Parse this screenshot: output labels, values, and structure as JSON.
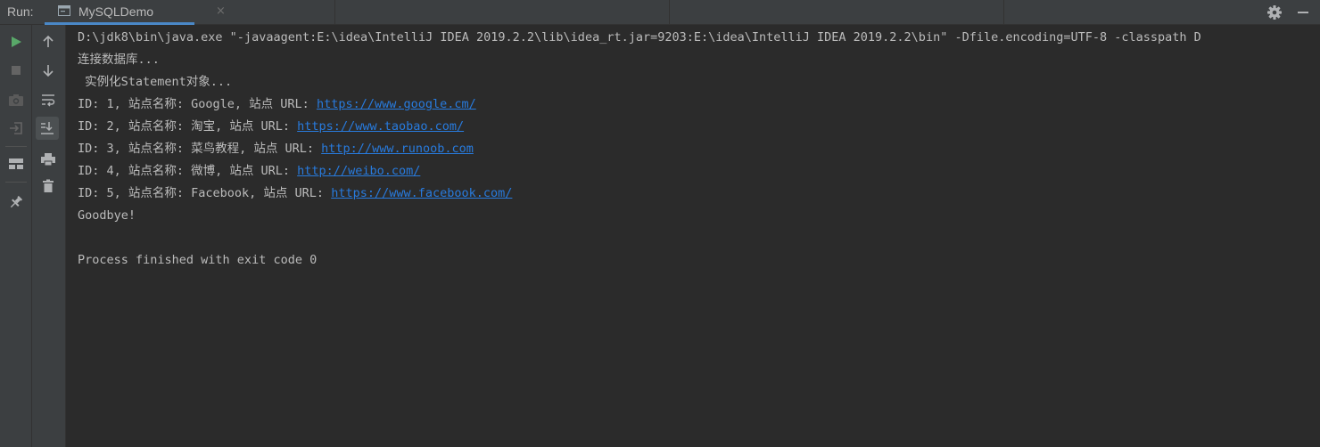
{
  "header": {
    "run_label": "Run:",
    "tab_label": "MySQLDemo",
    "tab_close": "×"
  },
  "toolbar_left": {
    "buttons": [
      {
        "icon": "play-icon",
        "label": "Rerun",
        "color": "#59a869"
      },
      {
        "icon": "stop-icon",
        "label": "Stop",
        "color": "#646464"
      },
      {
        "icon": "camera-icon",
        "label": "Dump Threads",
        "color": "#646464"
      },
      {
        "icon": "exit-icon",
        "label": "Exit",
        "color": "#646464"
      },
      {
        "icon": "layout-icon",
        "label": "Restore Layout",
        "color": "#afb1b3"
      },
      {
        "icon": "pin-icon",
        "label": "Pin Tab",
        "color": "#afb1b3"
      }
    ]
  },
  "toolbar_right": {
    "buttons": [
      {
        "icon": "arrow-up-icon",
        "label": "Up the Stack Trace"
      },
      {
        "icon": "arrow-down-icon",
        "label": "Down the Stack Trace"
      },
      {
        "icon": "soft-wrap-icon",
        "label": "Soft-Wrap"
      },
      {
        "icon": "scroll-to-end-icon",
        "label": "Scroll to the End"
      },
      {
        "icon": "print-icon",
        "label": "Print"
      },
      {
        "icon": "trash-icon",
        "label": "Clear All"
      }
    ]
  },
  "console": {
    "lines": [
      {
        "text": "D:\\jdk8\\bin\\java.exe \"-javaagent:E:\\idea\\IntelliJ IDEA 2019.2.2\\lib\\idea_rt.jar=9203:E:\\idea\\IntelliJ IDEA 2019.2.2\\bin\" -Dfile.encoding=UTF-8 -classpath D",
        "link": ""
      },
      {
        "text": "连接数据库...",
        "link": ""
      },
      {
        "text": " 实例化Statement对象...",
        "link": ""
      },
      {
        "text": "ID: 1, 站点名称: Google, 站点 URL: ",
        "link": "https://www.google.cm/"
      },
      {
        "text": "ID: 2, 站点名称: 淘宝, 站点 URL: ",
        "link": "https://www.taobao.com/"
      },
      {
        "text": "ID: 3, 站点名称: 菜鸟教程, 站点 URL: ",
        "link": "http://www.runoob.com"
      },
      {
        "text": "ID: 4, 站点名称: 微博, 站点 URL: ",
        "link": "http://weibo.com/"
      },
      {
        "text": "ID: 5, 站点名称: Facebook, 站点 URL: ",
        "link": "https://www.facebook.com/"
      },
      {
        "text": "Goodbye!",
        "link": ""
      },
      {
        "text": "",
        "link": ""
      },
      {
        "text": "Process finished with exit code 0",
        "link": ""
      }
    ]
  },
  "colors": {
    "background": "#2b2b2b",
    "panel": "#3c3f41",
    "text": "#bbbbbb",
    "link": "#287bde",
    "run_green": "#59a869",
    "tab_underline": "#4a88c7"
  }
}
